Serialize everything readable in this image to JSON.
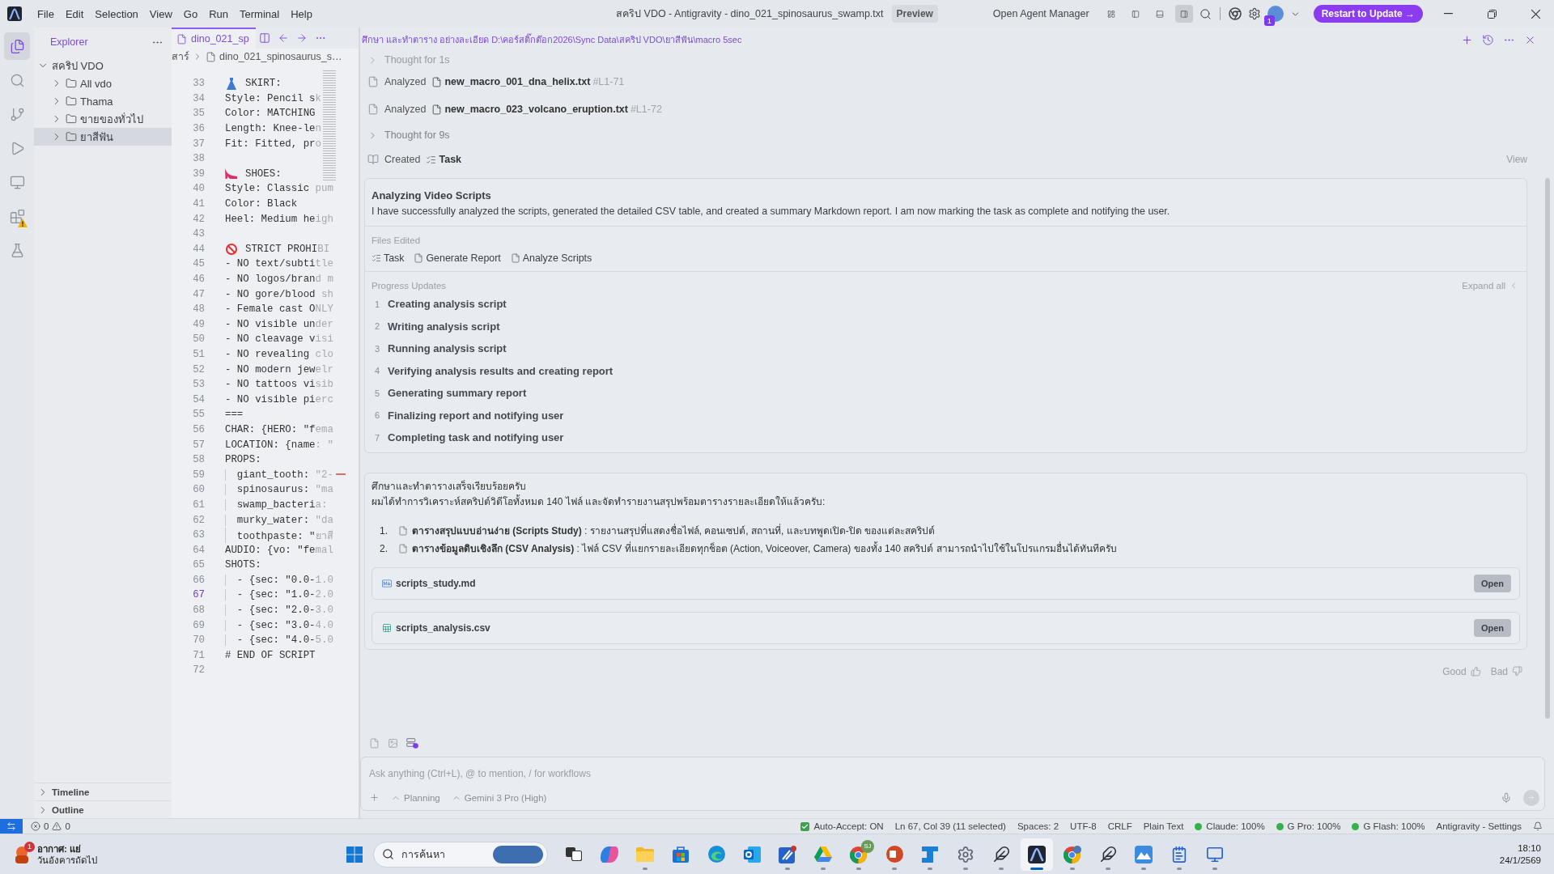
{
  "title_bar": {
    "menu": [
      "File",
      "Edit",
      "Selection",
      "View",
      "Go",
      "Run",
      "Terminal",
      "Help"
    ],
    "title": "สคริป VDO - Antigravity - dino_021_spinosaurus_swamp.txt",
    "preview": "Preview",
    "agent_manager": "Open Agent Manager",
    "layout_toggles": [
      {
        "kind": "grid",
        "selected": false
      },
      {
        "kind": "left",
        "selected": false
      },
      {
        "kind": "bottom",
        "selected": false
      },
      {
        "kind": "right",
        "selected": true
      }
    ],
    "account_badge": "1",
    "update_button": "Restart to Update →"
  },
  "activity_bar": [
    {
      "kind": "files",
      "selected": true,
      "warning": false
    },
    {
      "kind": "search",
      "selected": false,
      "warning": false
    },
    {
      "kind": "source-control",
      "selected": false,
      "warning": false
    },
    {
      "kind": "run",
      "selected": false,
      "warning": false
    },
    {
      "kind": "remote",
      "selected": false,
      "warning": false
    },
    {
      "kind": "extensions",
      "selected": false,
      "warning": true
    },
    {
      "kind": "testing",
      "selected": false,
      "warning": false
    }
  ],
  "explorer": {
    "title": "Explorer",
    "tree": [
      {
        "label": "สคริป VDO",
        "expanded": true,
        "selected": false,
        "children": [
          {
            "label": "All vdo",
            "expanded": false,
            "selected": false
          },
          {
            "label": "Thama",
            "expanded": false,
            "selected": false
          },
          {
            "label": "ขายของทั่วไป",
            "expanded": false,
            "selected": false
          },
          {
            "label": "ยาสีฟัน",
            "expanded": false,
            "selected": true
          }
        ]
      }
    ],
    "sections": [
      {
        "label": "Timeline",
        "expanded": false
      },
      {
        "label": "Outline",
        "expanded": false
      }
    ]
  },
  "editor": {
    "tab": {
      "label": "dino_021_sp",
      "selected": true
    },
    "breadcrumb": [
      "สาร์",
      "dino_021_spinosaurus_s…"
    ],
    "lines": [
      {
        "number": "33",
        "kind": "dress",
        "text": "SKIRT:",
        "active": false,
        "flagged": false
      },
      {
        "number": "34",
        "kind": "code",
        "text": "Style: Pencil sk",
        "active": false,
        "flagged": false
      },
      {
        "number": "35",
        "kind": "code",
        "text": "Color: MATCHING",
        "active": false,
        "flagged": false
      },
      {
        "number": "36",
        "kind": "code",
        "text": "Length: Knee-len",
        "active": false,
        "flagged": false
      },
      {
        "number": "37",
        "kind": "code",
        "text": "Fit: Fitted, pro",
        "active": false,
        "flagged": false
      },
      {
        "number": "38",
        "kind": "code",
        "active": false,
        "flagged": false
      },
      {
        "number": "39",
        "kind": "shoe",
        "text": "SHOES:",
        "active": false,
        "flagged": false
      },
      {
        "number": "40",
        "kind": "code",
        "text": "Style: Classic pum",
        "active": false,
        "flagged": false
      },
      {
        "number": "41",
        "kind": "code",
        "text": "Color: Black",
        "active": false,
        "flagged": false
      },
      {
        "number": "42",
        "kind": "code",
        "text": "Heel: Medium heigh",
        "active": false,
        "flagged": false
      },
      {
        "number": "43",
        "kind": "code",
        "active": false,
        "flagged": false
      },
      {
        "number": "44",
        "kind": "prohibited",
        "text": "STRICT PROHIBI",
        "active": false,
        "flagged": false
      },
      {
        "number": "45",
        "kind": "code",
        "text": "- NO text/subtitle",
        "active": false,
        "flagged": false
      },
      {
        "number": "46",
        "kind": "code",
        "text": "- NO logos/brand m",
        "active": false,
        "flagged": false
      },
      {
        "number": "47",
        "kind": "code",
        "text": "- NO gore/blood sh",
        "active": false,
        "flagged": false
      },
      {
        "number": "48",
        "kind": "code",
        "text": "- Female cast ONLY",
        "active": false,
        "flagged": false
      },
      {
        "number": "49",
        "kind": "code",
        "text": "- NO visible under",
        "active": false,
        "flagged": false
      },
      {
        "number": "50",
        "kind": "code",
        "text": "- NO cleavage visi",
        "active": false,
        "flagged": false
      },
      {
        "number": "51",
        "kind": "code",
        "text": "- NO revealing clo",
        "active": false,
        "flagged": false
      },
      {
        "number": "52",
        "kind": "code",
        "text": "- NO modern jewelr",
        "active": false,
        "flagged": false
      },
      {
        "number": "53",
        "kind": "code",
        "text": "- NO tattoos visib",
        "active": false,
        "flagged": false
      },
      {
        "number": "54",
        "kind": "code",
        "text": "- NO visible pierc",
        "active": false,
        "flagged": false
      },
      {
        "number": "55",
        "kind": "code",
        "text": "===",
        "active": false,
        "flagged": false
      },
      {
        "number": "56",
        "kind": "code",
        "text": "CHAR: {HERO: \"fema",
        "active": false,
        "flagged": false
      },
      {
        "number": "57",
        "kind": "code",
        "text": "LOCATION: {name: \"",
        "active": false,
        "flagged": false
      },
      {
        "number": "58",
        "kind": "code",
        "text": "PROPS:",
        "active": false,
        "flagged": false
      },
      {
        "number": "59",
        "kind": "code",
        "text": "  giant_tooth: \"2-",
        "active": false,
        "flagged": true
      },
      {
        "number": "60",
        "kind": "code",
        "text": "  spinosaurus: \"ma",
        "active": false,
        "flagged": false
      },
      {
        "number": "61",
        "kind": "code",
        "text": "  swamp_bacteria:",
        "active": false,
        "flagged": false
      },
      {
        "number": "62",
        "kind": "code",
        "text": "  murky_water: \"da",
        "active": false,
        "flagged": false
      },
      {
        "number": "63",
        "kind": "code",
        "text": "  toothpaste: \"ยาสี",
        "active": false,
        "flagged": false
      },
      {
        "number": "64",
        "kind": "code",
        "text": "AUDIO: {vo: \"femal",
        "active": false,
        "flagged": false
      },
      {
        "number": "65",
        "kind": "code",
        "text": "SHOTS:",
        "active": false,
        "flagged": false
      },
      {
        "number": "66",
        "kind": "code",
        "text": "  - {sec: \"0.0-1.0",
        "active": false,
        "flagged": false
      },
      {
        "number": "67",
        "kind": "code",
        "text": "  - {sec: \"1.0-2.0",
        "active": true,
        "flagged": false
      },
      {
        "number": "68",
        "kind": "code",
        "text": "  - {sec: \"2.0-3.0",
        "active": false,
        "flagged": false
      },
      {
        "number": "69",
        "kind": "code",
        "text": "  - {sec: \"3.0-4.0",
        "active": false,
        "flagged": false
      },
      {
        "number": "70",
        "kind": "code",
        "text": "  - {sec: \"4.0-5.0",
        "active": false,
        "flagged": false
      },
      {
        "number": "71",
        "kind": "code",
        "text": "# END OF SCRIPT",
        "active": false,
        "flagged": false
      },
      {
        "number": "72",
        "kind": "code",
        "active": false,
        "flagged": false
      }
    ]
  },
  "agent": {
    "path": "ศึกษา และทำตาราง อย่างละเอียด D:\\คอร์สติ๊กต๊อก2026\\Sync Data\\สคริป VDO\\ยาสีฟัน\\macro 5sec",
    "steps": [
      {
        "kind": "thought",
        "label": "Thought for 1s"
      },
      {
        "kind": "analyzed",
        "label": "Analyzed",
        "file": "new_macro_001_dna_helix.txt",
        "range": "#L1-71"
      },
      {
        "kind": "analyzed",
        "label": "Analyzed",
        "file": "new_macro_023_volcano_eruption.txt",
        "range": "#L1-72"
      },
      {
        "kind": "thought",
        "label": "Thought for 9s"
      },
      {
        "kind": "created",
        "label": "Created",
        "file": "Task",
        "action": "View"
      }
    ],
    "task_card": {
      "title": "Analyzing Video Scripts",
      "summary": "I have successfully analyzed the scripts, generated the detailed CSV table, and created a summary Markdown report. I am now marking the task as complete and notifying the user.",
      "files_heading": "Files Edited",
      "files": [
        {
          "kind": "task",
          "name": "Task"
        },
        {
          "kind": "doc",
          "name": "Generate Report"
        },
        {
          "kind": "doc",
          "name": "Analyze Scripts"
        }
      ],
      "progress_heading": "Progress Updates",
      "expand_label": "Expand all",
      "updates": [
        {
          "number": "1",
          "text": "Creating analysis script"
        },
        {
          "number": "2",
          "text": "Writing analysis script"
        },
        {
          "number": "3",
          "text": "Running analysis script"
        },
        {
          "number": "4",
          "text": "Verifying analysis results and creating report"
        },
        {
          "number": "5",
          "text": "Generating summary report"
        },
        {
          "number": "6",
          "text": "Finalizing report and notifying user"
        },
        {
          "number": "7",
          "text": "Completing task and notifying user"
        }
      ]
    },
    "reply": {
      "paragraphs": [
        "ศึกษาและทำตารางเสร็จเรียบร้อยครับ",
        "ผมได้ทำการวิเคราะห์สคริปต์วิดีโอทั้งหมด 140 ไฟล์ และจัดทำรายงานสรุปพร้อมตารางรายละเอียดให้แล้วครับ:"
      ],
      "items": [
        {
          "number": "1.",
          "text": "**ตารางสรุปแบบอ่านง่าย (Scripts Study)** : รายงานสรุปที่แสดงชื่อไฟล์, คอนเซปต์, สถานที่, และบทพูดเปิด-ปิด ของแต่ละสคริปต์"
        },
        {
          "number": "2.",
          "text": "**ตารางข้อมูลดิบเชิงลึก (CSV Analysis)** : ไฟล์ CSV ที่แยกรายละเอียดทุกช็อต (Action, Voiceover, Camera) ของทั้ง 140 สคริปต์ สามารถนำไปใช้ในโปรแกรมอื่นได้ทันทีครับ"
        }
      ],
      "attachments": [
        {
          "kind": "markdown",
          "name": "scripts_study.md",
          "button": "Open"
        },
        {
          "kind": "sheet",
          "name": "scripts_analysis.csv",
          "button": "Open"
        }
      ]
    },
    "feedback": [
      {
        "kind": "up",
        "label": "Good"
      },
      {
        "kind": "down",
        "label": "Bad"
      }
    ],
    "input": {
      "placeholder": "Ask anything (Ctrl+L), @ to mention, / for workflows",
      "mode": "Planning",
      "model": "Gemini 3 Pro (High)"
    }
  },
  "status_bar": {
    "errors": "0",
    "warnings": "0",
    "auto_accept": {
      "label": "Auto-Accept: ON",
      "checked": true
    },
    "items": [
      "Ln 67, Col 39 (11 selected)",
      "Spaces: 2",
      "UTF-8",
      "CRLF",
      "Plain Text"
    ],
    "quotas": [
      "Claude: 100%",
      "G Pro: 100%",
      "G Flash: 100%"
    ],
    "settings": "Antigravity - Settings"
  },
  "taskbar": {
    "weather": {
      "title": "อากาศ: แย่",
      "subtitle": "วันอังคารถัดไป",
      "badge": "1"
    },
    "search_placeholder": "การค้นหา",
    "apps": [
      {
        "kind": "task-view",
        "open": false,
        "selected": false
      },
      {
        "kind": "copilot",
        "open": false,
        "selected": false
      },
      {
        "kind": "folder",
        "open": true,
        "selected": false
      },
      {
        "kind": "store",
        "open": false,
        "selected": false
      },
      {
        "kind": "edge",
        "open": false,
        "selected": false
      },
      {
        "kind": "outlook",
        "open": false,
        "selected": false
      },
      {
        "kind": "pen",
        "open": true,
        "selected": false
      },
      {
        "kind": "drive",
        "open": true,
        "selected": false
      },
      {
        "kind": "chrome",
        "open": true,
        "selected": false,
        "badge": "SJ"
      },
      {
        "kind": "pdf",
        "open": true,
        "selected": false
      },
      {
        "kind": "bracket",
        "open": true,
        "selected": false
      },
      {
        "kind": "settings",
        "open": true,
        "selected": false
      },
      {
        "kind": "feather",
        "open": true,
        "selected": false
      },
      {
        "kind": "antigravity",
        "open": true,
        "selected": true
      },
      {
        "kind": "chrome-avatar",
        "open": true,
        "selected": false
      },
      {
        "kind": "feather",
        "open": true,
        "selected": false
      },
      {
        "kind": "mountain",
        "open": true,
        "selected": false
      },
      {
        "kind": "notepad",
        "open": true,
        "selected": false
      },
      {
        "kind": "monitor",
        "open": true,
        "selected": false
      }
    ],
    "clock": {
      "time": "18:10",
      "date": "24/1/2569"
    }
  }
}
